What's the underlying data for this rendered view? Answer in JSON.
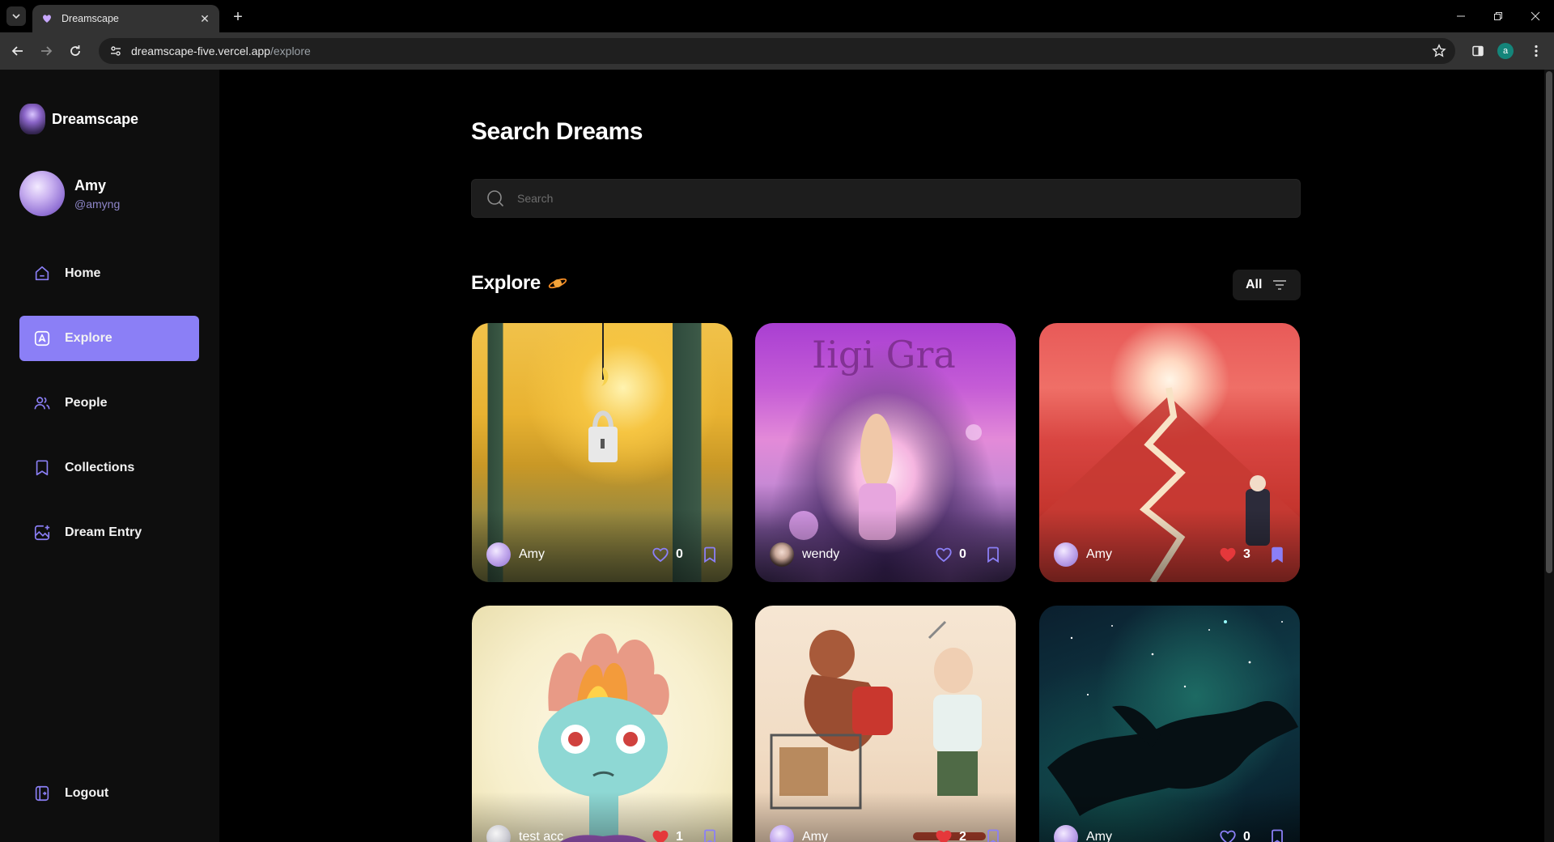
{
  "browser": {
    "tab_title": "Dreamscape",
    "url_host": "dreamscape-five.vercel.app",
    "url_path": "/explore",
    "profile_initial": "a"
  },
  "sidebar": {
    "brand": "Dreamscape",
    "user": {
      "name": "Amy",
      "handle": "@amyng"
    },
    "items": [
      {
        "label": "Home",
        "icon": "home-icon",
        "active": false
      },
      {
        "label": "Explore",
        "icon": "explore-icon",
        "active": true
      },
      {
        "label": "People",
        "icon": "people-icon",
        "active": false
      },
      {
        "label": "Collections",
        "icon": "bookmark-icon",
        "active": false
      },
      {
        "label": "Dream Entry",
        "icon": "image-plus-icon",
        "active": false
      }
    ],
    "logout": "Logout"
  },
  "main": {
    "title": "Search Dreams",
    "search_placeholder": "Search",
    "section_title": "Explore",
    "filter_label": "All"
  },
  "colors": {
    "accent": "#8b7ff6",
    "like_active": "#e5383b",
    "icon_purple": "#8b7ff6"
  },
  "cards": [
    {
      "author": "Amy",
      "likes": "0",
      "liked": false,
      "saved": false
    },
    {
      "author": "wendy",
      "likes": "0",
      "liked": false,
      "saved": false
    },
    {
      "author": "Amy",
      "likes": "3",
      "liked": true,
      "saved": true
    },
    {
      "author": "test acc",
      "likes": "1",
      "liked": true,
      "saved": false
    },
    {
      "author": "Amy",
      "likes": "2",
      "liked": true,
      "saved": false
    },
    {
      "author": "Amy",
      "likes": "0",
      "liked": false,
      "saved": false
    }
  ]
}
